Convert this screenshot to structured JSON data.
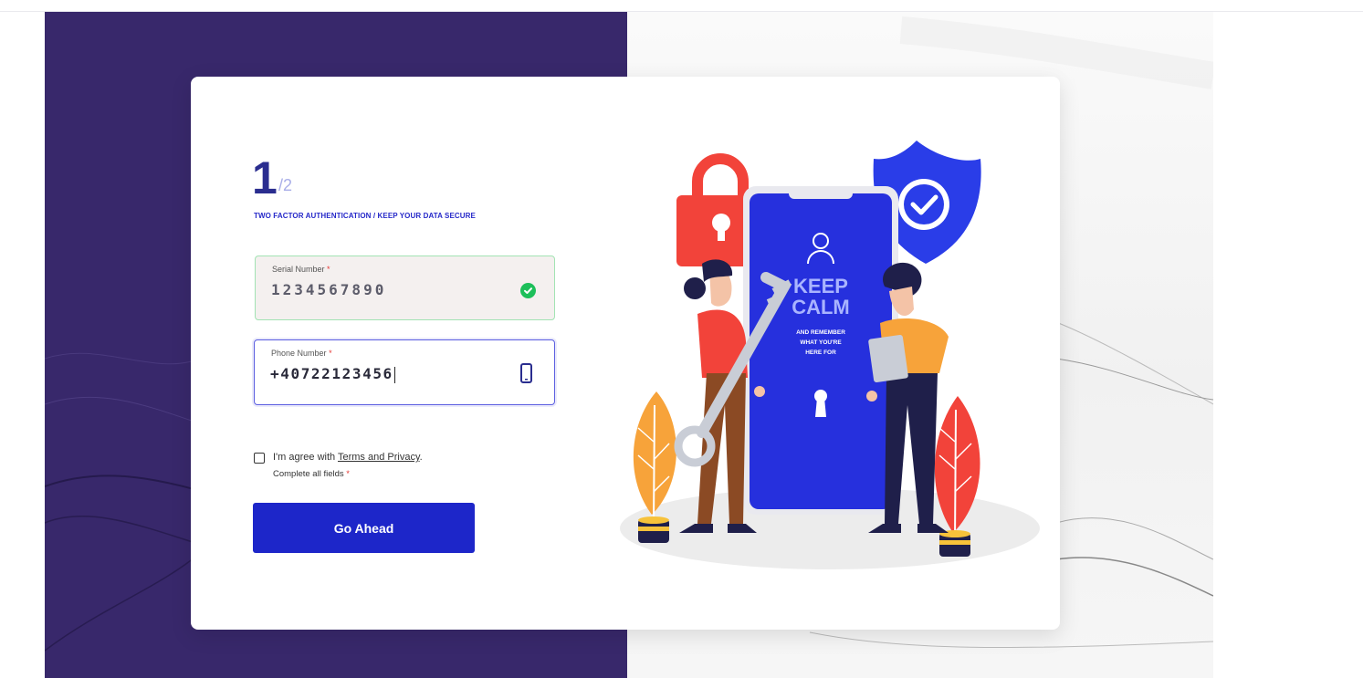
{
  "step": {
    "current": "1",
    "total": "/2"
  },
  "subtitle": "TWO FACTOR AUTHENTICATION / KEEP YOUR DATA SECURE",
  "serial": {
    "label": "Serial Number",
    "required_mark": "*",
    "value": "1234567890",
    "status_icon": "check-circle-icon"
  },
  "phone": {
    "label": "Phone Number",
    "required_mark": "*",
    "value": "+40722123456",
    "icon": "mobile-phone-icon"
  },
  "agree": {
    "prefix": "I'm agree with ",
    "link": "Terms and Privacy",
    "suffix": ".",
    "checked": false
  },
  "complete": {
    "text": "Complete all fields ",
    "required_mark": "*"
  },
  "button": {
    "label": "Go Ahead"
  },
  "illustration": {
    "line1": "KEEP",
    "line2": "CALM",
    "line3": "AND REMEMBER",
    "line4": "WHAT YOU'RE",
    "line5": "HERE FOR"
  },
  "colors": {
    "accent": "#1d26c9",
    "left_panel": "#38286b",
    "success": "#1dbf5a",
    "required": "#e53935"
  }
}
